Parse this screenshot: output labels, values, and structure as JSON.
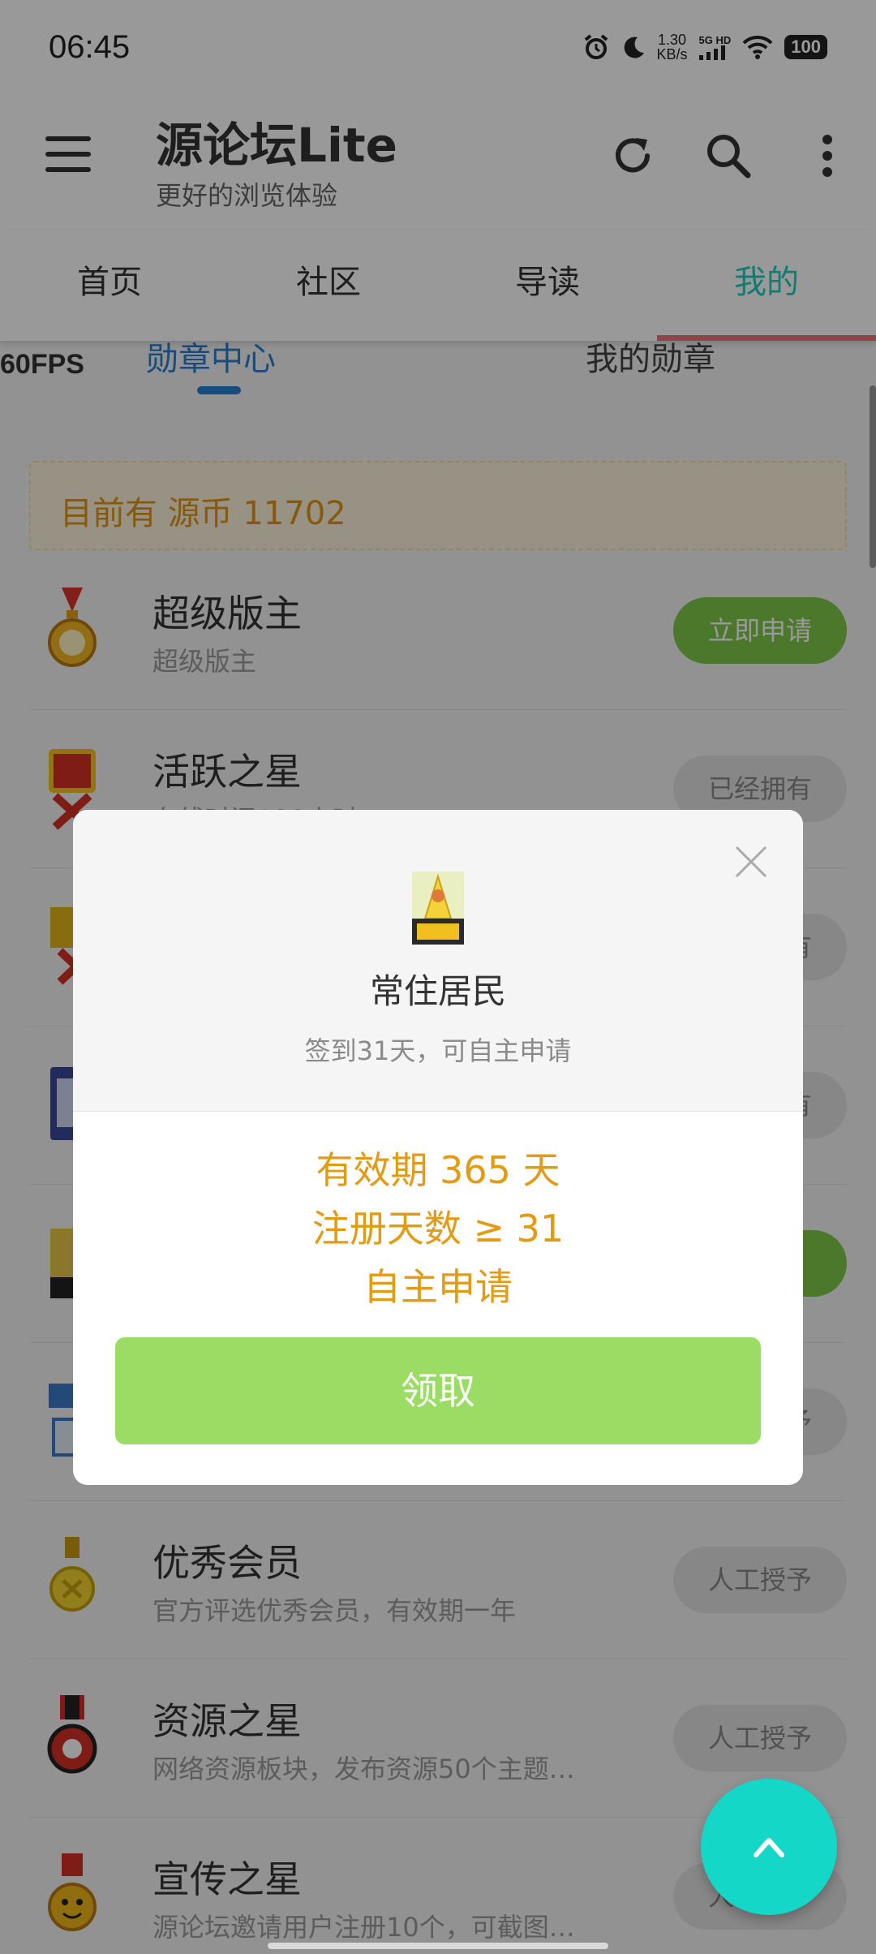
{
  "status_bar": {
    "time": "06:45",
    "net_speed_value": "1.30",
    "net_speed_unit": "KB/s",
    "signal_label": "5G HD",
    "battery": "100"
  },
  "app_bar": {
    "title": "源论坛Lite",
    "subtitle": "更好的浏览体验"
  },
  "main_tabs": [
    {
      "label": "首页",
      "active": false
    },
    {
      "label": "社区",
      "active": false
    },
    {
      "label": "导读",
      "active": false
    },
    {
      "label": "我的",
      "active": true
    }
  ],
  "sub_tabs": {
    "fps": "60FPS",
    "items": [
      {
        "label": "勋章中心",
        "active": true
      },
      {
        "label": "我的勋章",
        "active": false
      }
    ]
  },
  "coin_banner": "目前有 源币 11702",
  "medals": [
    {
      "title": "超级版主",
      "desc": "超级版主",
      "button": "立即申请",
      "style": "green",
      "icon": "gold-medal-icon"
    },
    {
      "title": "活跃之星",
      "desc": "在线时间100小时",
      "button": "已经拥有",
      "style": "grey",
      "icon": "red-medal-icon"
    },
    {
      "title": "",
      "desc": "",
      "button": "已经拥有",
      "style": "grey",
      "icon": "medal-icon"
    },
    {
      "title": "",
      "desc": "",
      "button": "已经拥有",
      "style": "grey",
      "icon": "medal-icon"
    },
    {
      "title": "",
      "desc": "",
      "button": "领取",
      "style": "green",
      "icon": "medal-icon"
    },
    {
      "title": "",
      "desc": "",
      "button": "人工授予",
      "style": "grey",
      "icon": "medal-icon"
    },
    {
      "title": "优秀会员",
      "desc": "官方评选优秀会员，有效期一年",
      "button": "人工授予",
      "style": "grey",
      "icon": "yellow-medal-icon"
    },
    {
      "title": "资源之星",
      "desc": "网络资源板块，发布资源50个主题…",
      "button": "人工授予",
      "style": "grey",
      "icon": "red-star-medal-icon"
    },
    {
      "title": "宣传之星",
      "desc": "源论坛邀请用户注册10个，可截图…",
      "button": "人工授予",
      "style": "grey",
      "icon": "face-medal-icon"
    }
  ],
  "dialog": {
    "medal_title": "常住居民",
    "medal_subtitle": "签到31天，可自主申请",
    "conditions": [
      "有效期 365 天",
      "注册天数 ≥ 31",
      "自主申请"
    ],
    "button": "领取"
  },
  "colors": {
    "accent": "#1ecfc0",
    "tab_indicator": "#f0707a",
    "green_button": "#9bdc64",
    "condition_text": "#e39a14",
    "fab": "#15d7c7"
  }
}
